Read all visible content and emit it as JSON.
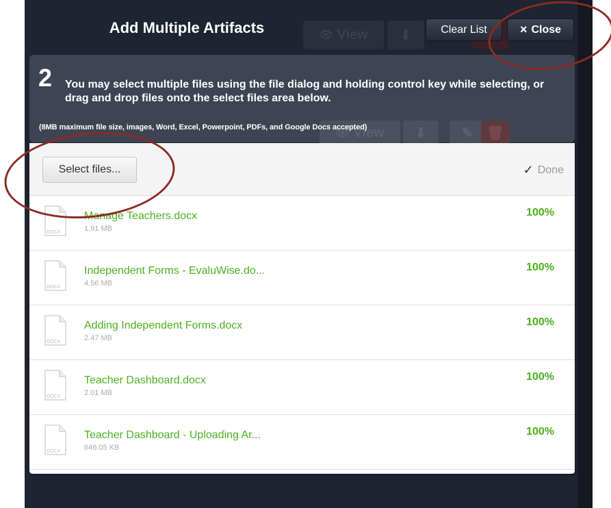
{
  "dialog": {
    "title": "Add Multiple Artifacts",
    "clear_list_label": "Clear List",
    "close_label": "Close",
    "close_icon": "×"
  },
  "background": {
    "ghost_view_label": "View"
  },
  "info": {
    "step_number": "2",
    "instructions": "You may select multiple files using the file dialog and holding control key while selecting, or drag and drop files onto the select files area below.",
    "note": "(8MB maximum file size, images, Word, Excel, Powerpoint, PDFs, and Google Docs accepted)"
  },
  "toolbar": {
    "select_files_label": "Select files...",
    "done_label": "Done",
    "done_icon": "✓"
  },
  "files": [
    {
      "name": "Manage Teachers.docx",
      "size": "1.91 MB",
      "progress": "100%",
      "type": "DOCX"
    },
    {
      "name": "Independent Forms - EvaluWise.do...",
      "size": "4.56 MB",
      "progress": "100%",
      "type": "DOCX"
    },
    {
      "name": "Adding Independent Forms.docx",
      "size": "2.47 MB",
      "progress": "100%",
      "type": "DOCX"
    },
    {
      "name": "Teacher Dashboard.docx",
      "size": "2.01 MB",
      "progress": "100%",
      "type": "DOCX"
    },
    {
      "name": "Teacher Dashboard - Uploading Ar...",
      "size": "646.05 KB",
      "progress": "100%",
      "type": "DOCX"
    }
  ],
  "colors": {
    "success_green": "#4caf1f",
    "annotation_red": "#8b2a24",
    "dialog_dark": "#1f2432"
  }
}
